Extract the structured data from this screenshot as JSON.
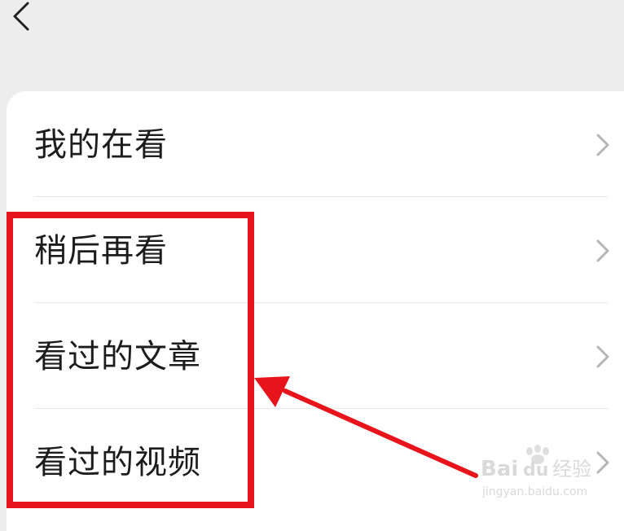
{
  "nav": {
    "back_icon": "chevron-left-icon"
  },
  "menu": {
    "items": [
      {
        "label": "我的在看",
        "icon": "chevron-right-icon"
      },
      {
        "label": "稍后再看",
        "icon": "chevron-right-icon"
      },
      {
        "label": "看过的文章",
        "icon": "chevron-right-icon"
      },
      {
        "label": "看过的视频",
        "icon": "chevron-right-icon"
      }
    ]
  },
  "annotation": {
    "highlight_color": "#e8141c",
    "arrow_color": "#e8141c"
  },
  "colors": {
    "background": "#ededed",
    "card": "#ffffff",
    "text": "#1c1c1c",
    "chevron": "#b5b5b5"
  }
}
